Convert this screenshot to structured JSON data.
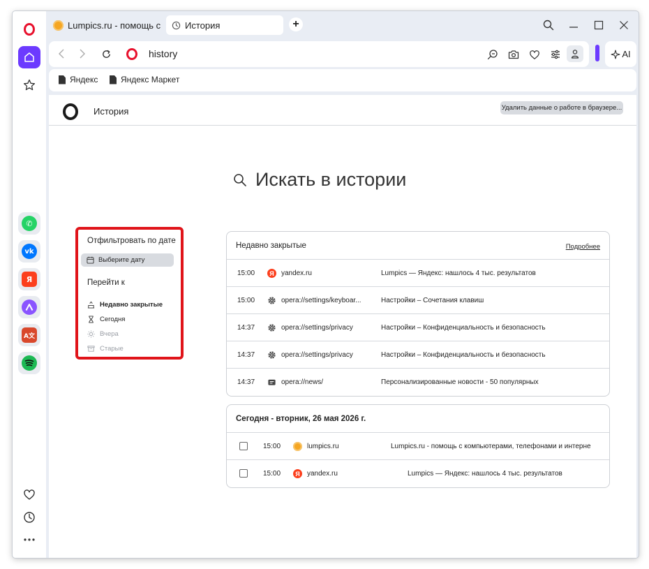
{
  "tabs": [
    {
      "label": "Lumpics.ru - помощь с ко",
      "active": false
    },
    {
      "label": "История",
      "active": true
    }
  ],
  "address": {
    "url": "history"
  },
  "ai_label": "AI",
  "bookmarks": [
    "Яндекс",
    "Яндекс Маркет"
  ],
  "page": {
    "title": "История",
    "clear_button": "Удалить данные о работе в браузере...",
    "search_placeholder": "Искать в истории"
  },
  "filter": {
    "title": "Отфильтровать по дате",
    "date_button": "Выберите дату",
    "goto_label": "Перейти к",
    "items": [
      {
        "label": "Недавно закрытые",
        "icon": "recently-closed-icon",
        "state": "active"
      },
      {
        "label": "Сегодня",
        "icon": "hourglass-icon",
        "state": "normal"
      },
      {
        "label": "Вчера",
        "icon": "sun-icon",
        "state": "disabled"
      },
      {
        "label": "Старые",
        "icon": "archive-icon",
        "state": "disabled"
      }
    ]
  },
  "recent": {
    "title": "Недавно закрытые",
    "more_link": "Подробнее",
    "rows": [
      {
        "time": "15:00",
        "icon": "yandex-favicon",
        "site": "yandex.ru",
        "title": "Lumpics — Яндекс: нашлось 4 тыс. результатов"
      },
      {
        "time": "15:00",
        "icon": "gear-icon",
        "site": "opera://settings/keyboar...",
        "title": "Настройки – Сочетания клавиш"
      },
      {
        "time": "14:37",
        "icon": "gear-icon",
        "site": "opera://settings/privacy",
        "title": "Настройки – Конфиденциальность и безопасность"
      },
      {
        "time": "14:37",
        "icon": "gear-icon",
        "site": "opera://settings/privacy",
        "title": "Настройки – Конфиденциальность и безопасность"
      },
      {
        "time": "14:37",
        "icon": "news-icon",
        "site": "opera://news/",
        "title": "Персонализированные новости - 50 популярных"
      }
    ]
  },
  "today": {
    "title": "Сегодня - вторник, 26 мая 2026 г.",
    "rows": [
      {
        "time": "15:00",
        "icon": "lumpics-favicon",
        "site": "lumpics.ru",
        "title": "Lumpics.ru - помощь с компьютерами, телефонами и интерне"
      },
      {
        "time": "15:00",
        "icon": "yandex-favicon",
        "site": "yandex.ru",
        "title": "Lumpics — Яндекс: нашлось 4 тыс. результатов"
      }
    ]
  },
  "colors": {
    "opera_red": "#e8112d",
    "accent_purple": "#6c3aff",
    "highlight_red": "#e0141a",
    "yandex_red": "#fc3f1d"
  }
}
